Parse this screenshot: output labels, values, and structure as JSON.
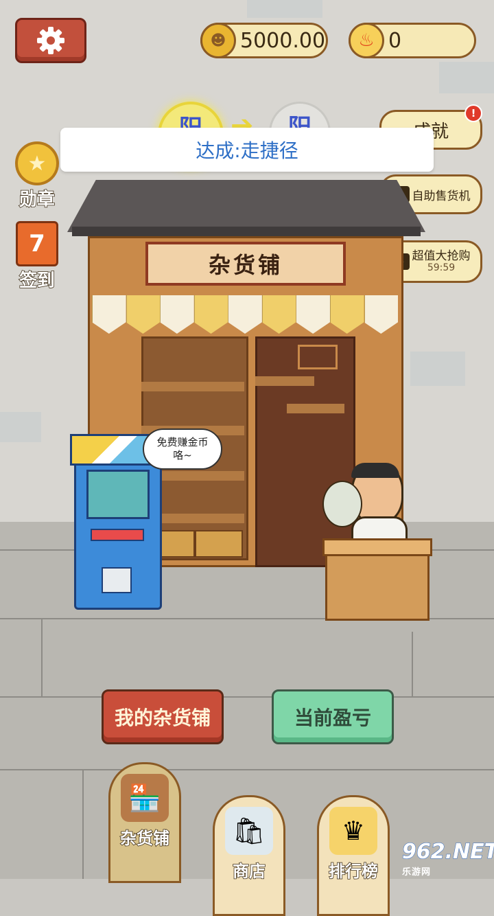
{
  "top_bar": {
    "coins": "5000.00",
    "fire_count": "0"
  },
  "yin_yang": {
    "from": "阳",
    "to": "阳"
  },
  "toast": "达成:走捷径",
  "left_menu": {
    "medal_label": "勋章",
    "checkin_label": "签到",
    "checkin_day": "7"
  },
  "right_menu": {
    "achievement": "成就",
    "achievement_badge": "!",
    "vending": "自助售货机",
    "deal": "超值大抢购",
    "deal_timer": "59:59"
  },
  "shop": {
    "sign": "杂货铺",
    "speech_line1": "免费赚金币",
    "speech_line2": "咯~"
  },
  "buttons": {
    "my_shop": "我的杂货铺",
    "profit": "当前盈亏"
  },
  "nav": {
    "shop": "杂货铺",
    "store": "商店",
    "rank": "排行榜"
  },
  "watermark": {
    "brand": "962.NET",
    "sub": "乐游网"
  },
  "colors": {
    "accent_red": "#c94e3a",
    "accent_green": "#7fd6a8",
    "pill_bg": "#f6e9b6",
    "toast_text": "#2e6fc6"
  }
}
